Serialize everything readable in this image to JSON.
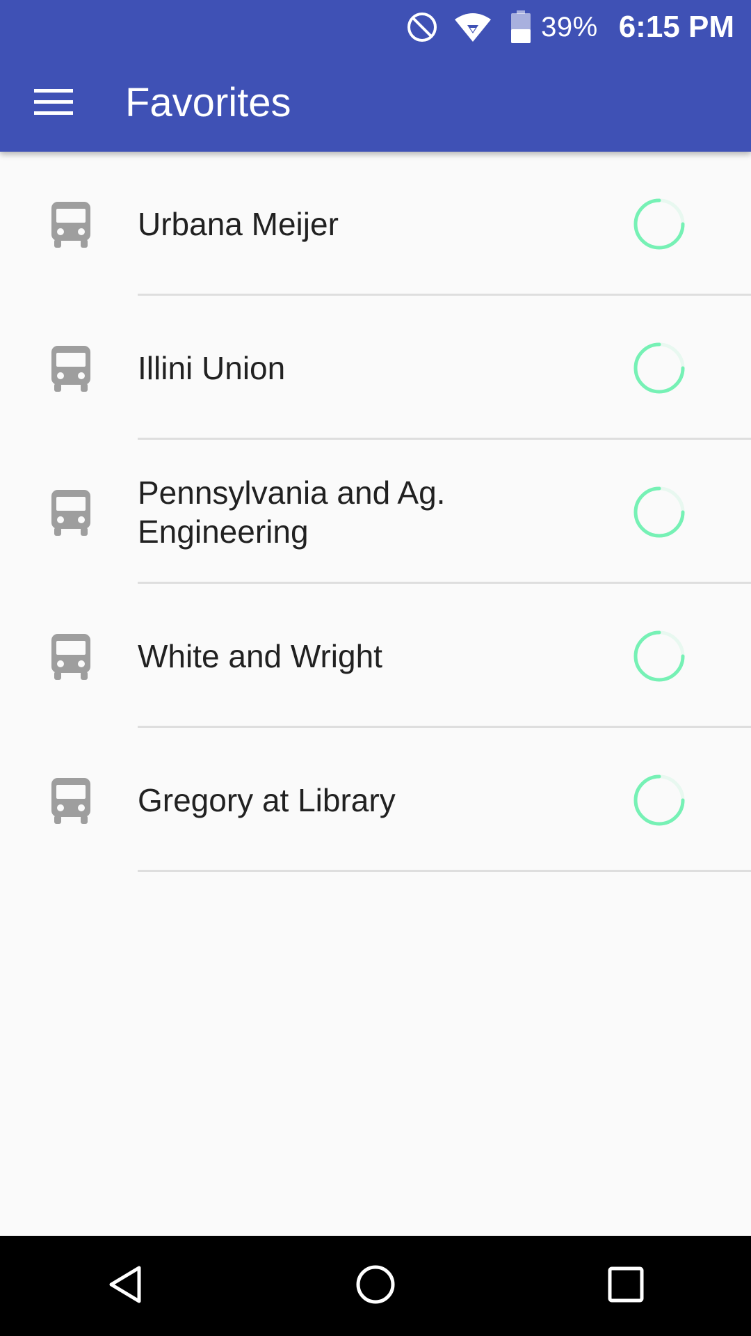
{
  "status_bar": {
    "icons": [
      "do-not-disturb-icon",
      "wifi-icon",
      "battery-icon"
    ],
    "battery_percent": "39%",
    "time": "6:15 PM"
  },
  "app_bar": {
    "menu_icon": "hamburger-menu-icon",
    "title": "Favorites"
  },
  "favorites": [
    {
      "icon": "bus-icon",
      "name": "Urbana Meijer",
      "status": "loading-spinner"
    },
    {
      "icon": "bus-icon",
      "name": "Illini Union",
      "status": "loading-spinner"
    },
    {
      "icon": "bus-icon",
      "name": "Pennsylvania and Ag. Engineering",
      "status": "loading-spinner"
    },
    {
      "icon": "bus-icon",
      "name": "White and Wright",
      "status": "loading-spinner"
    },
    {
      "icon": "bus-icon",
      "name": "Gregory at Library",
      "status": "loading-spinner"
    }
  ],
  "nav_bar": {
    "buttons": [
      "back-icon",
      "home-icon",
      "recents-icon"
    ]
  },
  "colors": {
    "primary": "#3f51b5",
    "background": "#fafafa",
    "spinner": "#69f0ae",
    "icon_gray": "#9e9e9e",
    "text": "#212121",
    "divider": "#dedede",
    "navbar": "#000000"
  }
}
